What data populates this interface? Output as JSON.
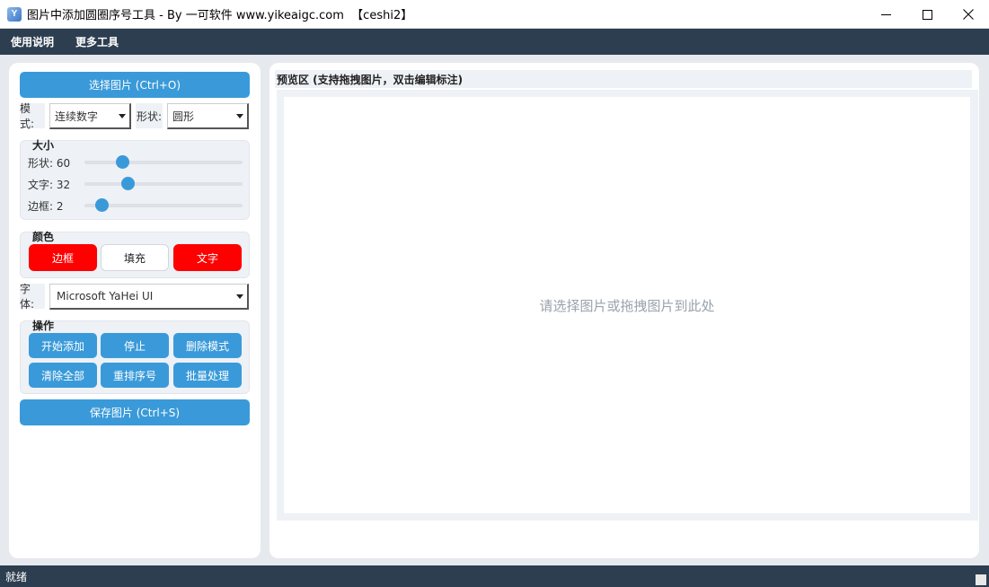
{
  "window": {
    "title": "图片中添加圆圈序号工具 - By 一可软件 www.yikeaigc.com  【ceshi2】",
    "app_icon_text": "Y",
    "controls": [
      "minimize-icon",
      "maximize-icon",
      "close-icon"
    ]
  },
  "menu": {
    "items": [
      "使用说明",
      "更多工具"
    ]
  },
  "left": {
    "select_image_button": "选择图片 (Ctrl+O)",
    "mode_label": "模式:",
    "mode_value": "连续数字",
    "shape_label": "形状:",
    "shape_value": "圆形",
    "size_group": {
      "title": "大小",
      "sliders": [
        {
          "label": "形状: 60",
          "value": 60,
          "fraction": 0.24
        },
        {
          "label": "文字: 32",
          "value": 32,
          "fraction": 0.27
        },
        {
          "label": "边框: 2",
          "value": 2,
          "fraction": 0.11
        }
      ]
    },
    "color_group": {
      "title": "颜色",
      "border": "边框",
      "fill": "填充",
      "text": "文字",
      "border_color": "#ff0000",
      "fill_color": "#ffffff",
      "text_color": "#ff0000"
    },
    "font_label": "字体:",
    "font_value": "Microsoft YaHei UI",
    "ops_group": {
      "title": "操作",
      "buttons": [
        "开始添加",
        "停止",
        "删除模式",
        "清除全部",
        "重排序号",
        "批量处理"
      ]
    },
    "save_button": "保存图片 (Ctrl+S)"
  },
  "preview": {
    "header": "预览区 (支持拖拽图片，双击编辑标注)",
    "placeholder": "请选择图片或拖拽图片到此处"
  },
  "status": {
    "text": "就绪"
  },
  "colors": {
    "accent": "#3a9ad9",
    "bar": "#2d3e50",
    "panel_bg": "#eef1f5",
    "red": "#ff0000"
  }
}
